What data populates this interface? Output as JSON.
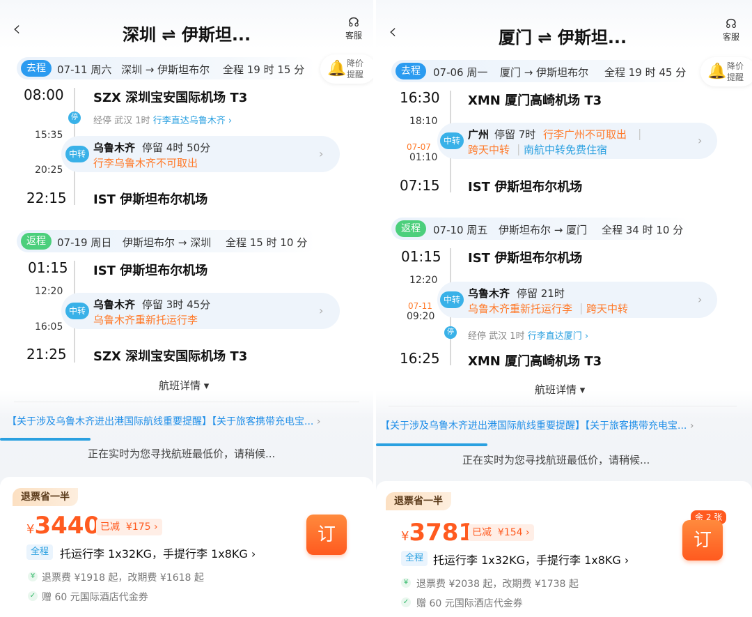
{
  "panels": [
    {
      "header": {
        "title": "深圳 ⇌ 伊斯坦...",
        "service_label": "客服",
        "back": "‹"
      },
      "price_alert": {
        "line1": "降价",
        "line2": "提醒"
      },
      "outbound": {
        "tag": "去程",
        "date": "07-11 周六",
        "route": "深圳 → 伊斯坦布尔",
        "duration": "全程 19 时 15 分",
        "dep_time": "08:00",
        "dep_airport": "SZX 深圳宝安国际机场 T3",
        "stop_dot": "停",
        "stop_text": "经停 武汉 1时",
        "stop_link": "行李直达乌鲁木齐 ›",
        "transfer_arr": "15:35",
        "transfer_dep": "20:25",
        "transfer_badge": "中转",
        "transfer_city": "乌鲁木齐",
        "transfer_stay": "停留 4时 50分",
        "transfer_note": "行李乌鲁木齐不可取出",
        "arr_time": "22:15",
        "arr_airport": "IST 伊斯坦布尔机场"
      },
      "return": {
        "tag": "返程",
        "date": "07-19 周日",
        "route": "伊斯坦布尔 → 深圳",
        "duration": "全程 15 时 10 分",
        "dep_time": "01:15",
        "dep_airport": "IST 伊斯坦布尔机场",
        "transfer_arr": "12:20",
        "transfer_dep": "16:05",
        "transfer_badge": "中转",
        "transfer_city": "乌鲁木齐",
        "transfer_stay": "停留 3时 45分",
        "transfer_note": "乌鲁木齐重新托运行李",
        "arr_time": "21:25",
        "arr_airport": "SZX 深圳宝安国际机场 T3"
      },
      "details_label": "航班详情 ▾",
      "notice": "【关于涉及乌鲁木齐进出港国际航线重要提醒】【关于旅客携带充电宝...",
      "progress": 0.25,
      "searching": "正在实时为您寻找航班最低价，请稍候...",
      "offer": {
        "save_tag": "退票省一半",
        "currency": "¥",
        "price": "3440",
        "reduced_label": "已减",
        "reduced_amount": "¥175 ›",
        "order_label": "订",
        "full_tag": "全程",
        "baggage": "托运行李 1x32KG，手提行李 1x8KG ›",
        "fee": "退票费 ¥1918 起，改期费 ¥1618 起",
        "gift": "赠 60 元国际酒店代金券"
      }
    },
    {
      "header": {
        "title": "厦门 ⇌ 伊斯坦...",
        "service_label": "客服",
        "back": "‹"
      },
      "price_alert": {
        "line1": "降价",
        "line2": "提醒"
      },
      "outbound": {
        "tag": "去程",
        "date": "07-06 周一",
        "route": "厦门 → 伊斯坦布尔",
        "duration": "全程 19 时 45 分",
        "dep_time": "16:30",
        "dep_airport": "XMN 厦门高崎机场 T3",
        "transfer_arr": "18:10",
        "transfer_dep_date": "07-07",
        "transfer_dep": "01:10",
        "transfer_badge": "中转",
        "transfer_city": "广州",
        "transfer_stay": "停留 7时",
        "transfer_note": "行李广州不可取出",
        "transfer_note2": "跨天中转",
        "transfer_note3": "南航中转免费住宿",
        "arr_time": "07:15",
        "arr_airport": "IST 伊斯坦布尔机场"
      },
      "return": {
        "tag": "返程",
        "date": "07-10 周五",
        "route": "伊斯坦布尔 → 厦门",
        "duration": "全程 34 时 10 分",
        "dep_time": "01:15",
        "dep_airport": "IST 伊斯坦布尔机场",
        "transfer_arr": "12:20",
        "transfer_dep_date": "07-11",
        "transfer_dep": "09:20",
        "transfer_badge": "中转",
        "transfer_city": "乌鲁木齐",
        "transfer_stay": "停留 21时",
        "transfer_note": "乌鲁木齐重新托运行李",
        "transfer_note2": "跨天中转",
        "stop_dot": "停",
        "stop_text": "经停 武汉 1时",
        "stop_link": "行李直达厦门 ›",
        "arr_time": "16:25",
        "arr_airport": "XMN 厦门高崎机场 T3"
      },
      "details_label": "航班详情 ▾",
      "notice": "【关于涉及乌鲁木齐进出港国际航线重要提醒】【关于旅客携带充电宝...",
      "progress": 0.3,
      "searching": "正在实时为您寻找航班最低价，请稍候...",
      "offer": {
        "save_tag": "退票省一半",
        "currency": "¥",
        "price": "3781",
        "reduced_label": "已减",
        "reduced_amount": "¥154 ›",
        "remain": "余 2 张",
        "order_label": "订",
        "full_tag": "全程",
        "baggage": "托运行李 1x32KG，手提行李 1x8KG ›",
        "fee": "退票费 ¥2038 起，改期费 ¥1738 起",
        "gift": "赠 60 元国际酒店代金券"
      }
    }
  ]
}
